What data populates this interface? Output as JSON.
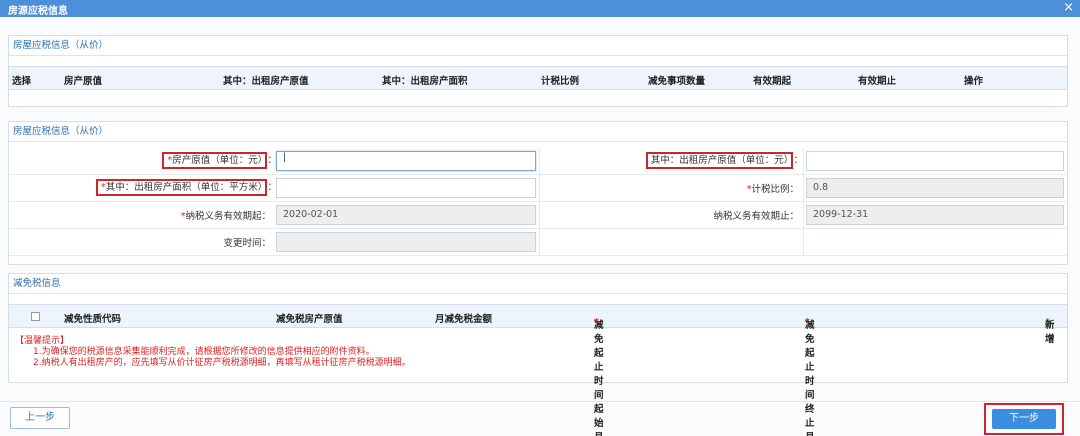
{
  "window": {
    "title": "房源应税信息",
    "close_glyph": "×"
  },
  "panel1": {
    "title": "房屋应税信息（从价）",
    "columns": [
      "选择",
      "房产原值",
      "其中：出租房产原值",
      "其中：出租房产面积",
      "计税比例",
      "减免事项数量",
      "有效期起",
      "有效期止",
      "操作"
    ]
  },
  "panel2": {
    "title": "房屋应税信息（从价）",
    "fields": {
      "original_value": {
        "label": "房产原值（单位：元）",
        "suffix": "：",
        "value": "|"
      },
      "rent_value": {
        "label": "其中：出租房产原值（单位：元）",
        "suffix": "：",
        "value": ""
      },
      "rent_area": {
        "label": "其中：出租房产面积（单位：平方米）",
        "suffix": "：",
        "value": ""
      },
      "tax_ratio": {
        "label": "计税比例：",
        "value": "0.8"
      },
      "start_date": {
        "label": "纳税义务有效期起：",
        "value": "2020-02-01"
      },
      "end_date": {
        "label": "纳税义务有效期止：",
        "value": "2099-12-31"
      },
      "change_time": {
        "label": "变更时间：",
        "value": ""
      }
    },
    "required_mark": "*"
  },
  "panel3": {
    "title": "减免税信息",
    "columns": {
      "code": "减免性质代码",
      "property_value": "减免税房产原值",
      "monthly_amount": "月减免税金额",
      "start_month": "减免起止时间起始月份",
      "end_month": "减免起止时间终止月份"
    },
    "add_label": "新增",
    "add_glyph": "✎",
    "tips": [
      "【温馨提示】",
      "1.为确保您的税源信息采集能顺利完成，请根据您所修改的信息提供相应的附件资料。",
      "2.纳税人有出租房产的，应先填写从价计征房产税税源明细，再填写从租计征房产税税源明细。"
    ]
  },
  "footer": {
    "prev_label": "上一步",
    "next_label": "下一步"
  }
}
